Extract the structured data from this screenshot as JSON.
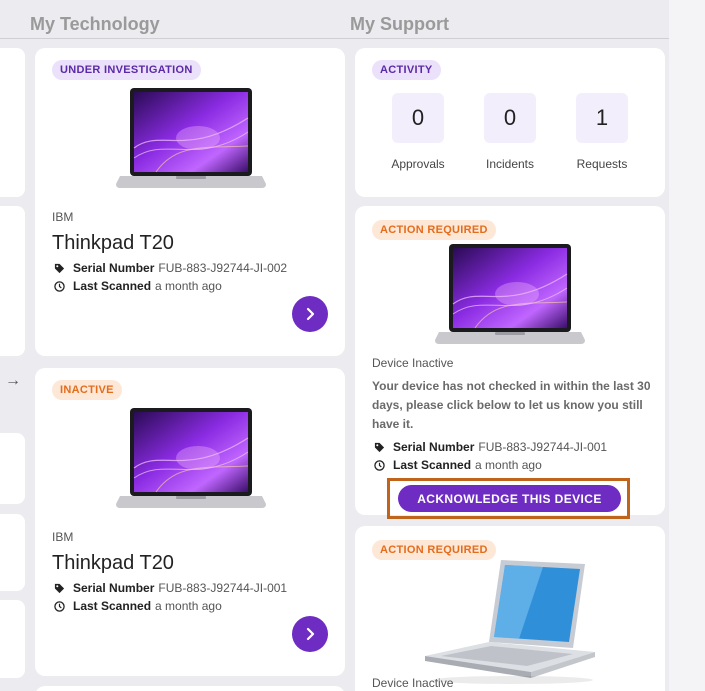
{
  "sections": {
    "technology_title": "My Technology",
    "support_title": "My Support"
  },
  "tech_cards": [
    {
      "badge": "UNDER INVESTIGATION",
      "brand": "IBM",
      "model": "Thinkpad T20",
      "serial_label": "Serial Number",
      "serial_value": "FUB-883-J92744-JI-002",
      "scanned_label": "Last Scanned",
      "scanned_value": "a month ago"
    },
    {
      "badge": "INACTIVE",
      "brand": "IBM",
      "model": "Thinkpad T20",
      "serial_label": "Serial Number",
      "serial_value": "FUB-883-J92744-JI-001",
      "scanned_label": "Last Scanned",
      "scanned_value": "a month ago"
    }
  ],
  "activity": {
    "badge": "ACTIVITY",
    "approvals": {
      "value": "0",
      "label": "Approvals"
    },
    "incidents": {
      "value": "0",
      "label": "Incidents"
    },
    "requests": {
      "value": "1",
      "label": "Requests"
    }
  },
  "action_cards": [
    {
      "badge": "ACTION REQUIRED",
      "status": "Device Inactive",
      "description": "Your device has not checked in within the last 30 days, please click below to let us know you still have it.",
      "serial_label": "Serial Number",
      "serial_value": "FUB-883-J92744-JI-001",
      "scanned_label": "Last Scanned",
      "scanned_value": "a month ago",
      "button": "ACKNOWLEDGE THIS DEVICE"
    },
    {
      "badge": "ACTION REQUIRED",
      "status": "Device Inactive"
    }
  ],
  "nav_arrow": "→",
  "colors": {
    "accent": "#6e2cc3",
    "highlight": "#c0641c",
    "badge_orange": "#e46d1c",
    "badge_purple": "#5b2aa6"
  }
}
